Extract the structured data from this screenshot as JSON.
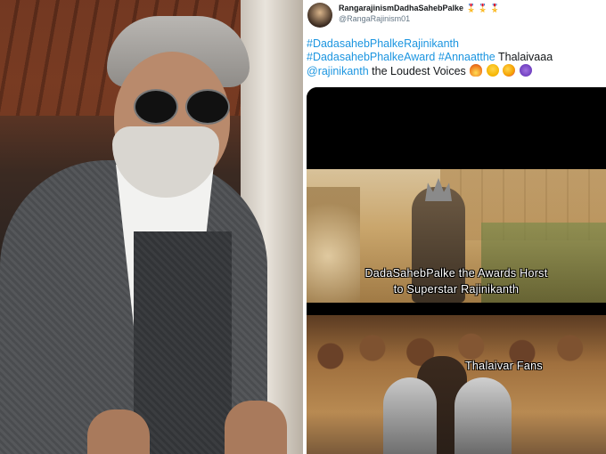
{
  "tweet": {
    "display_name": "RangarajinismDadhaSahebPalke",
    "name_emojis": "🎖️🎖️🎖️",
    "handle": "@RangaRajinism01",
    "line1_tag": "#DadasahebPhalkeRajinikanth",
    "line2_tag_a": "#DadasahebPhalkeAward",
    "line2_tag_b": "#Annaatthe",
    "line2_text": " Thalaivaaa",
    "line3_mention": "@rajinikanth",
    "line3_text": " the Loudest Voices ",
    "line3_emojis": [
      "fire-emoji",
      "sunglasses-emoji",
      "party-emoji",
      "devil-emoji"
    ]
  },
  "meme": {
    "caption_top_line1": "DadaSahebPalke the Awards Horst",
    "caption_top_line2": "to Superstar Rajinikanth",
    "caption_bottom": "Thalaivar Fans"
  },
  "colors": {
    "link": "#1b95e0",
    "text": "#14171a",
    "muted": "#657786"
  }
}
